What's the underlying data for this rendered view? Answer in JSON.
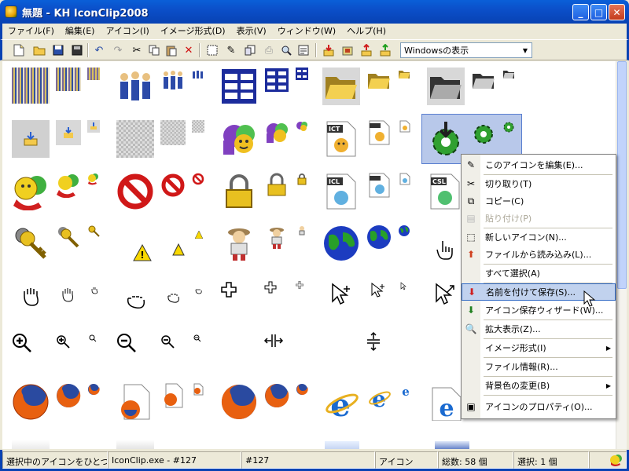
{
  "window": {
    "title": "無題 - KH IconClip2008"
  },
  "menubar": [
    "ファイル(F)",
    "編集(E)",
    "アイコン(I)",
    "イメージ形式(D)",
    "表示(V)",
    "ウィンドウ(W)",
    "ヘルプ(H)"
  ],
  "toolbar": {
    "view_select": "Windowsの表示"
  },
  "context_menu": {
    "items": [
      {
        "label": "このアイコンを編集(E)...",
        "icon": "pencil-icon"
      },
      {
        "label": "切り取り(T)",
        "icon": "scissors-icon"
      },
      {
        "label": "コピー(C)",
        "icon": "copy-icon"
      },
      {
        "label": "貼り付け(P)",
        "icon": "paste-icon",
        "disabled": true
      },
      {
        "label": "新しいアイコン(N)...",
        "icon": "new-icon-icon"
      },
      {
        "label": "ファイルから読み込み(L)...",
        "icon": "load-file-icon"
      },
      {
        "label": "すべて選択(A)",
        "icon": ""
      },
      {
        "label": "名前を付けて保存(S)...",
        "icon": "save-as-icon",
        "highlighted": true
      },
      {
        "label": "アイコン保存ウィザード(W)...",
        "icon": "save-wizard-icon"
      },
      {
        "label": "拡大表示(Z)...",
        "icon": "zoom-icon"
      },
      {
        "label": "イメージ形式(I)",
        "icon": "",
        "submenu": true
      },
      {
        "label": "ファイル情報(R)...",
        "icon": ""
      },
      {
        "label": "背景色の変更(B)",
        "icon": "",
        "submenu": true
      },
      {
        "label": "アイコンのプロパティ(O)...",
        "icon": "properties-icon"
      }
    ]
  },
  "icons": {
    "ict": "ICT",
    "icl": "ICL",
    "csl": "CSL"
  },
  "status": {
    "hint": "選択中のアイコンをひとつず",
    "file": "IconClip.exe - #127",
    "index": "#127",
    "type": "アイコン",
    "total": "総数: 58 個",
    "selected": "選択: 1 個"
  },
  "colors": {
    "titlebar": "#0842b3",
    "highlight": "#c1d2ee",
    "selection": "#b8c8ea"
  }
}
